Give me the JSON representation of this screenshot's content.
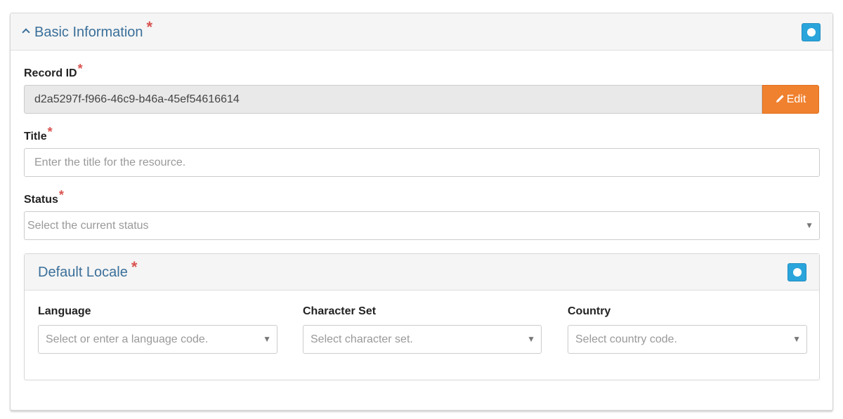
{
  "section": {
    "title": "Basic Information",
    "required_mark": "*"
  },
  "record_id": {
    "label": "Record ID",
    "required_mark": "*",
    "value": "d2a5297f-f966-46c9-b46a-45ef54616614",
    "edit_label": "Edit"
  },
  "title_field": {
    "label": "Title",
    "required_mark": "*",
    "placeholder": "Enter the title for the resource."
  },
  "status_field": {
    "label": "Status",
    "required_mark": "*",
    "placeholder": "Select the current status"
  },
  "default_locale": {
    "title": "Default Locale",
    "required_mark": "*",
    "language": {
      "label": "Language",
      "placeholder": "Select or enter a language code."
    },
    "character_set": {
      "label": "Character Set",
      "placeholder": "Select character set."
    },
    "country": {
      "label": "Country",
      "placeholder": "Select country code."
    }
  },
  "colors": {
    "heading_text": "#3a6f9a",
    "required": "#d9534f",
    "edit_button": "#f0812f",
    "toggle_button": "#2aa5dc"
  },
  "icons": {
    "collapse": "chevron-up-icon",
    "toggle": "circle-icon",
    "edit": "pencil-icon",
    "dropdown": "caret-down-icon"
  }
}
